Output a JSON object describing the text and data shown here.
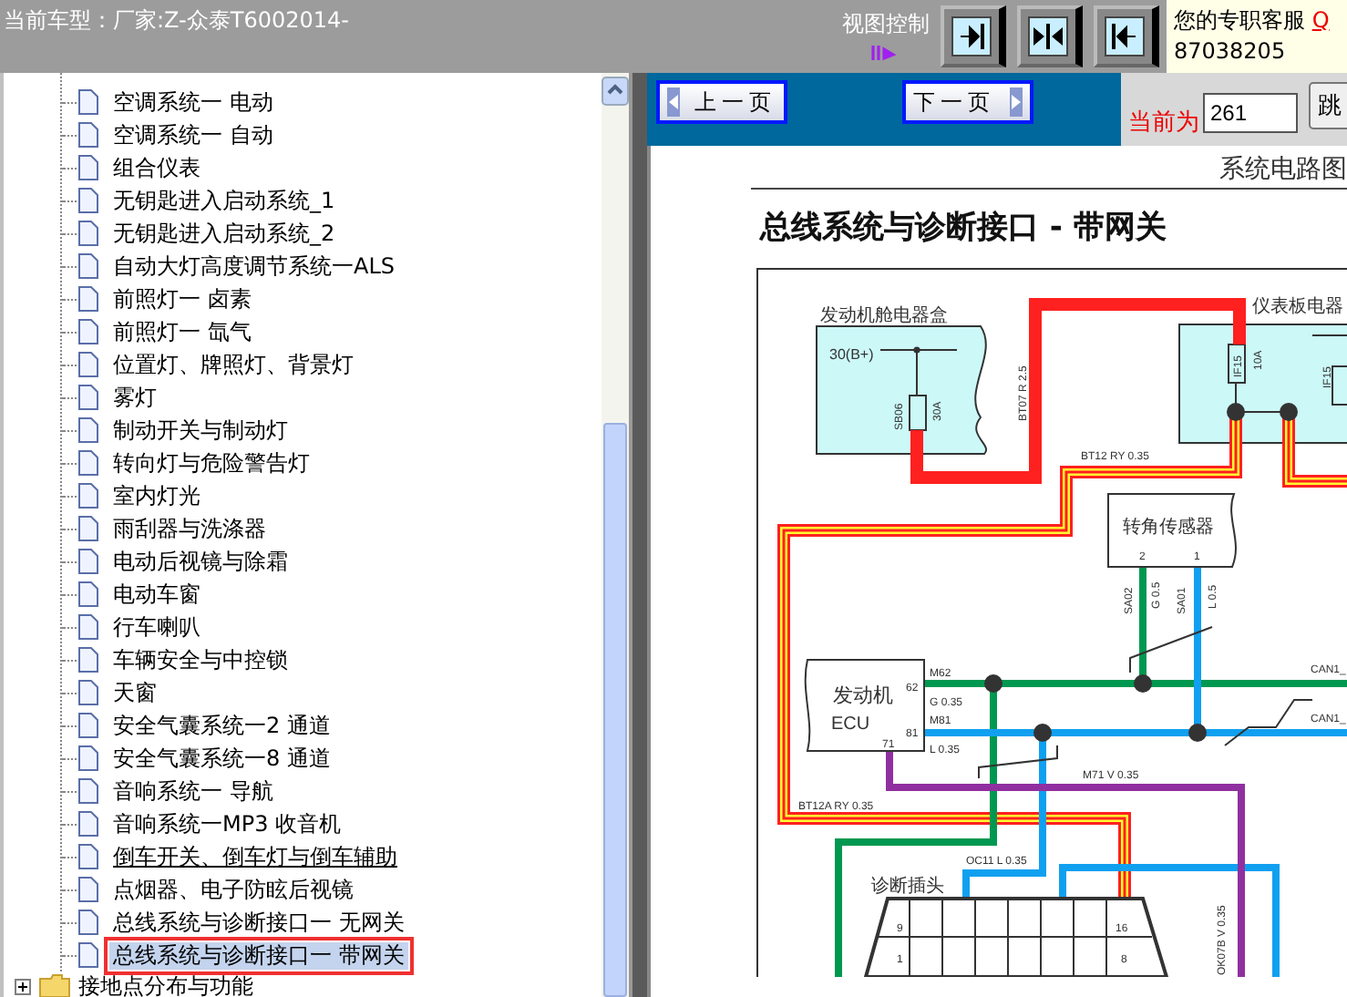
{
  "header": {
    "model": "当前车型：厂家:Z-众泰T6002014-",
    "view_control": "视图控制",
    "service": "您的专职客服",
    "service_link": "Q",
    "phone": "87038205"
  },
  "tree": {
    "items": [
      {
        "label": "空调系统一 电动",
        "selected": false,
        "underlined": false
      },
      {
        "label": "空调系统一 自动",
        "selected": false,
        "underlined": false
      },
      {
        "label": "组合仪表",
        "selected": false,
        "underlined": false
      },
      {
        "label": "无钥匙进入启动系统_1",
        "selected": false,
        "underlined": false
      },
      {
        "label": "无钥匙进入启动系统_2",
        "selected": false,
        "underlined": false
      },
      {
        "label": "自动大灯高度调节系统一ALS",
        "selected": false,
        "underlined": false
      },
      {
        "label": "前照灯一 卤素",
        "selected": false,
        "underlined": false
      },
      {
        "label": "前照灯一 氙气",
        "selected": false,
        "underlined": false
      },
      {
        "label": "位置灯、牌照灯、背景灯",
        "selected": false,
        "underlined": false
      },
      {
        "label": "雾灯",
        "selected": false,
        "underlined": false
      },
      {
        "label": "制动开关与制动灯",
        "selected": false,
        "underlined": false
      },
      {
        "label": "转向灯与危险警告灯",
        "selected": false,
        "underlined": false
      },
      {
        "label": "室内灯光",
        "selected": false,
        "underlined": false
      },
      {
        "label": "雨刮器与洗涤器",
        "selected": false,
        "underlined": false
      },
      {
        "label": "电动后视镜与除霜",
        "selected": false,
        "underlined": false
      },
      {
        "label": "电动车窗",
        "selected": false,
        "underlined": false
      },
      {
        "label": "行车喇叭",
        "selected": false,
        "underlined": false
      },
      {
        "label": "车辆安全与中控锁",
        "selected": false,
        "underlined": false
      },
      {
        "label": "天窗",
        "selected": false,
        "underlined": false
      },
      {
        "label": "安全气囊系统一2 通道",
        "selected": false,
        "underlined": false
      },
      {
        "label": "安全气囊系统一8 通道",
        "selected": false,
        "underlined": false
      },
      {
        "label": "音响系统一 导航",
        "selected": false,
        "underlined": false
      },
      {
        "label": "音响系统一MP3 收音机",
        "selected": false,
        "underlined": false
      },
      {
        "label": "倒车开关、倒车灯与倒车辅助",
        "selected": false,
        "underlined": true
      },
      {
        "label": "点烟器、电子防眩后视镜",
        "selected": false,
        "underlined": false
      },
      {
        "label": "总线系统与诊断接口一 无网关",
        "selected": false,
        "underlined": false
      },
      {
        "label": "总线系统与诊断接口一 带网关",
        "selected": true,
        "underlined": false
      }
    ],
    "folder": {
      "label": "接地点分布与功能",
      "expanded": false
    }
  },
  "nav": {
    "prev": "上一页",
    "next": "下一页",
    "current_label": "当前为",
    "page": "261",
    "go": "跳"
  },
  "document": {
    "header": "系统电路图",
    "title": "总线系统与诊断接口 - 带网关",
    "diagram_labels": [
      "发动机舱电器盒",
      "30(B+)",
      "SB06",
      "30A",
      "BT07 R 2.5",
      "仪表板电器",
      "IF15",
      "10A",
      "IF15",
      "BT12 RY 0.35",
      "转角传感器",
      "2",
      "1",
      "SA02",
      "G 0.5",
      "SA01",
      "L 0.5",
      "发动机",
      "ECU",
      "62",
      "81",
      "71",
      "M62",
      "G 0.35",
      "M81",
      "L 0.35",
      "CAN1_",
      "CAN1_",
      "M71 V 0.35",
      "BT12A RY 0.35",
      "诊断插头",
      "OC11 L 0.35",
      "9",
      "16",
      "1",
      "8",
      "OK07B V 0.35"
    ]
  }
}
